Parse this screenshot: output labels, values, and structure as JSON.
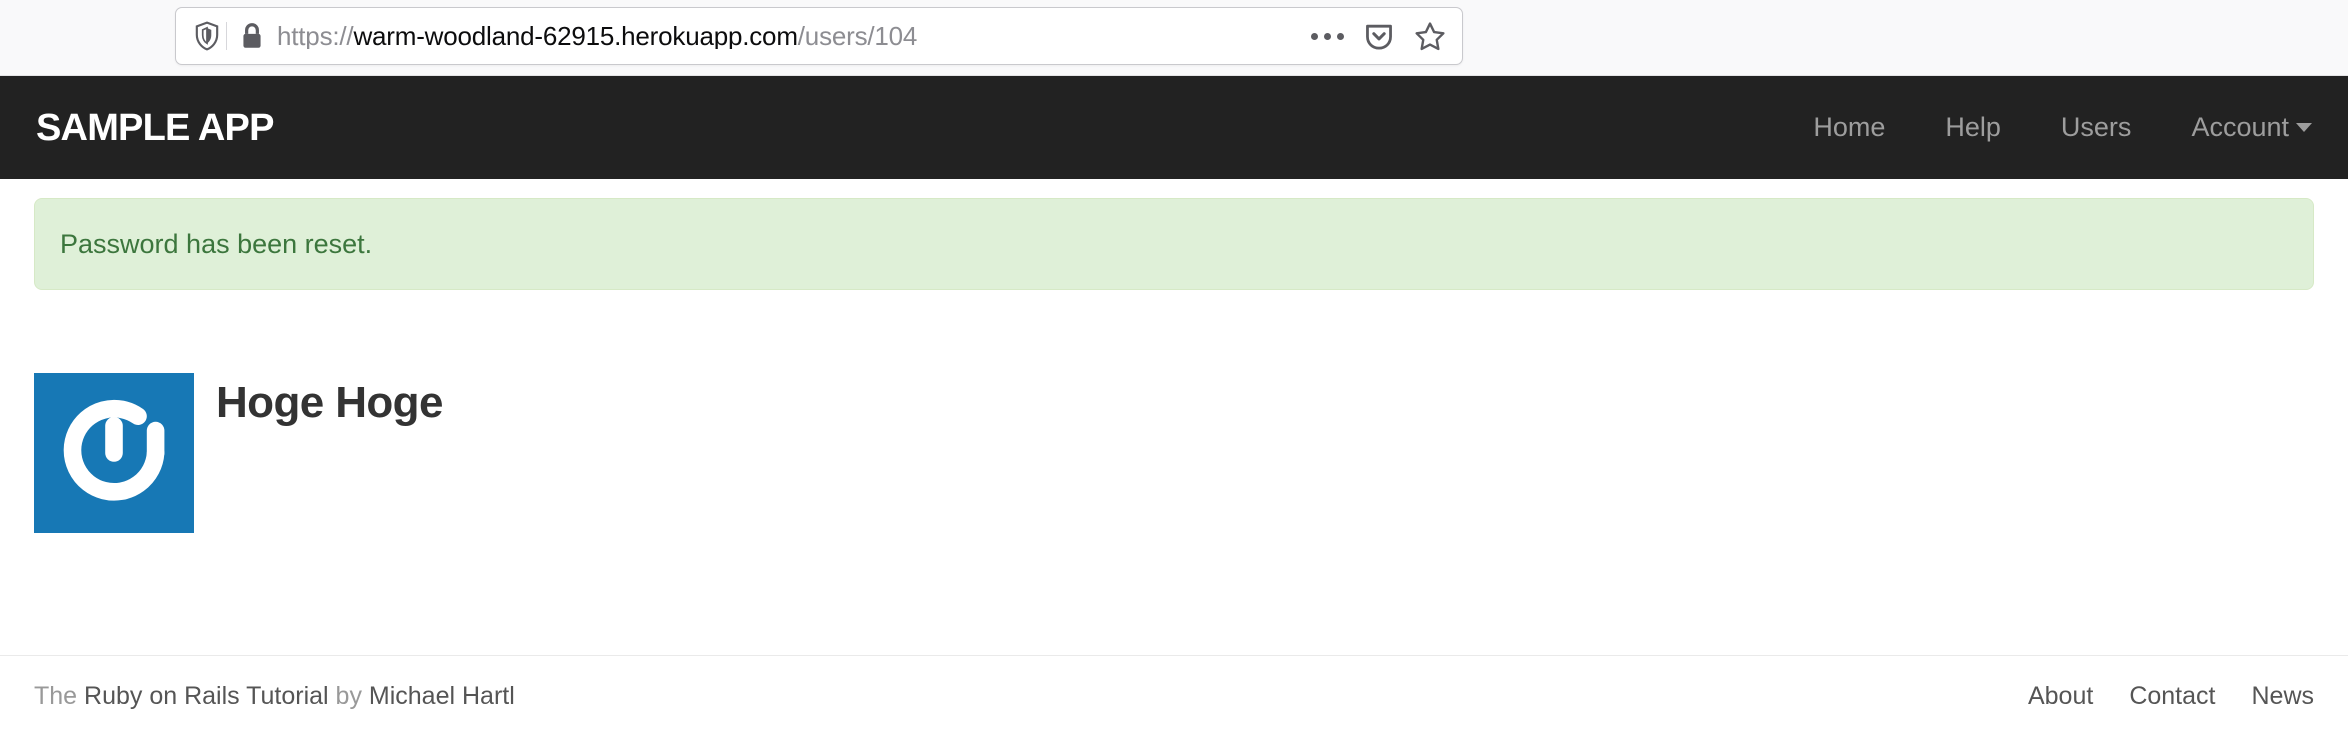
{
  "browser": {
    "url_protocol": "https://",
    "url_domain": "warm-woodland-62915.herokuapp.com",
    "url_path": "/users/104",
    "full_url": "https://warm-woodland-62915.herokuapp.com/users/104",
    "icons": {
      "shield": "shield-icon",
      "lock": "lock-icon",
      "more": "page-actions-icon",
      "pocket": "pocket-icon",
      "bookmark": "star-icon"
    }
  },
  "navbar": {
    "brand": "SAMPLE APP",
    "links": [
      {
        "label": "Home"
      },
      {
        "label": "Help"
      },
      {
        "label": "Users"
      },
      {
        "label": "Account",
        "has_caret": true
      }
    ],
    "background_color": "#222222",
    "link_color": "#9d9d9d"
  },
  "flash": {
    "message": "Password has been reset.",
    "type": "success",
    "background_color": "#dff0d8",
    "text_color": "#3c763d",
    "border_color": "#d6e9c6"
  },
  "user": {
    "name": "Hoge Hoge",
    "gravatar_alt": "Hoge Hoge",
    "gravatar_background": "#1778b5"
  },
  "footer": {
    "credit_prefix": "The ",
    "credit_link": "Ruby on Rails Tutorial",
    "credit_middle": " by ",
    "credit_author": "Michael Hartl",
    "links": [
      {
        "label": "About"
      },
      {
        "label": "Contact"
      },
      {
        "label": "News"
      }
    ]
  }
}
